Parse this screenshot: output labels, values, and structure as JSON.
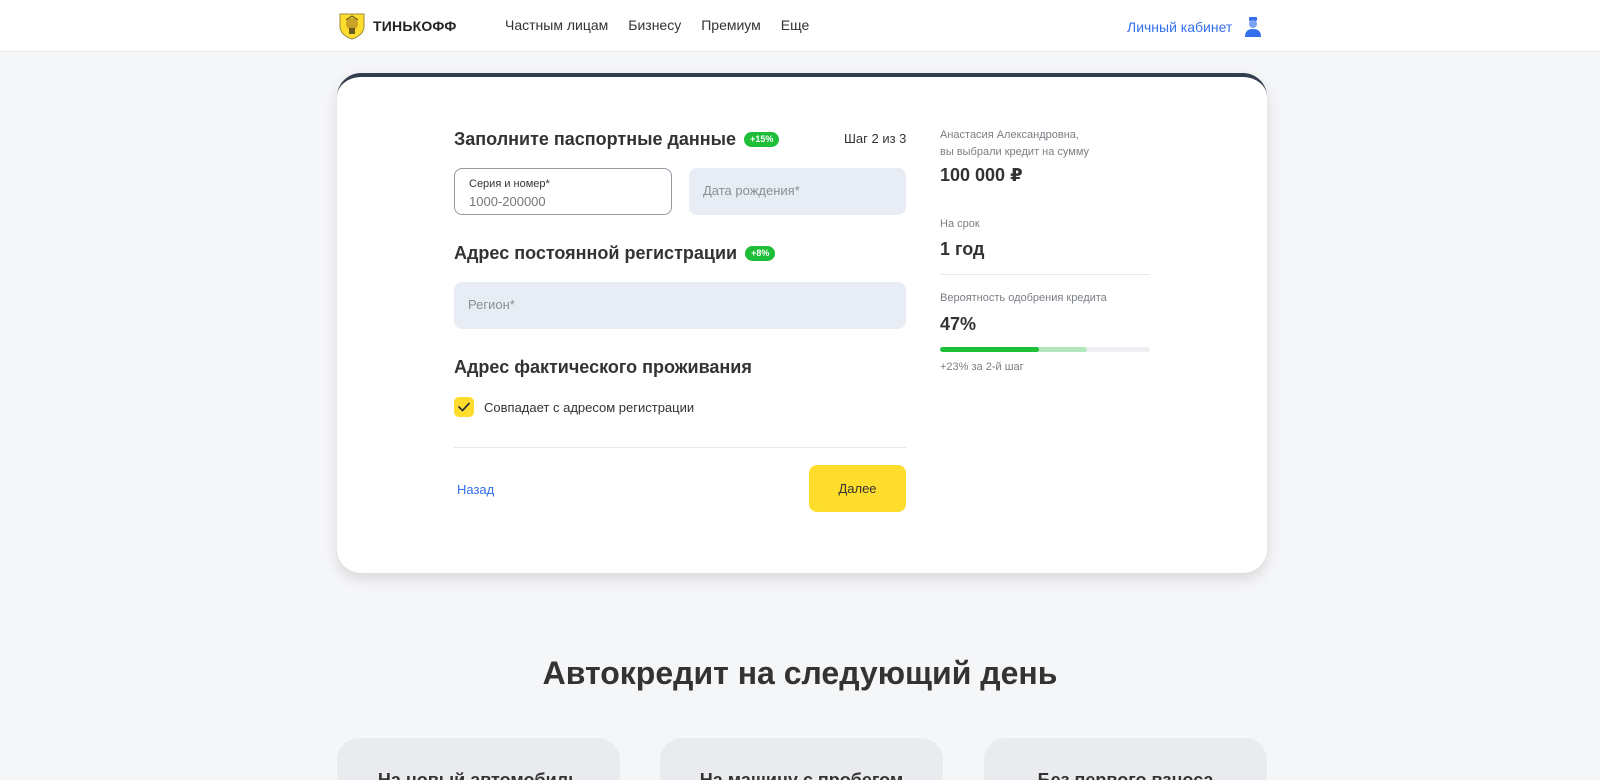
{
  "header": {
    "logo_text": "ТИНЬКОФФ",
    "nav": [
      "Частным лицам",
      "Бизнесу",
      "Премиум",
      "Еще"
    ],
    "cabinet_label": "Личный кабинет"
  },
  "form": {
    "passport_title": "Заполните паспортные данные",
    "passport_badge": "+15%",
    "step": "Шаг 2 из 3",
    "series_label": "Серия и номер*",
    "series_value": "1000-200000",
    "birth_placeholder": "Дата рождения*",
    "reg_title": "Адрес постоянной регистрации",
    "reg_badge": "+8%",
    "region_placeholder": "Регион*",
    "actual_title": "Адрес фактического проживания",
    "same_address_label": "Совпадает с адресом регистрации",
    "same_address_checked": true,
    "back_label": "Назад",
    "next_label": "Далее"
  },
  "summary": {
    "greeting_line1": "Анастасия Александровна,",
    "greeting_line2": "вы выбрали кредит на сумму",
    "amount": "100 000 ₽",
    "term_label": "На срок",
    "term_value": "1 год",
    "probability_label": "Вероятность одобрения кредита",
    "probability_value": "47%",
    "probability_current": 0.47,
    "probability_with_step": 0.7,
    "probability_note": "+23% за 2-й шаг"
  },
  "colors": {
    "accent_yellow": "#ffdd2d",
    "link_blue": "#336fee",
    "badge_green": "#1ebe39"
  },
  "lower": {
    "title": "Автокредит на следующий день",
    "features": [
      "На новый автомобиль",
      "На машину с пробегом",
      "Без первого взноса"
    ]
  }
}
